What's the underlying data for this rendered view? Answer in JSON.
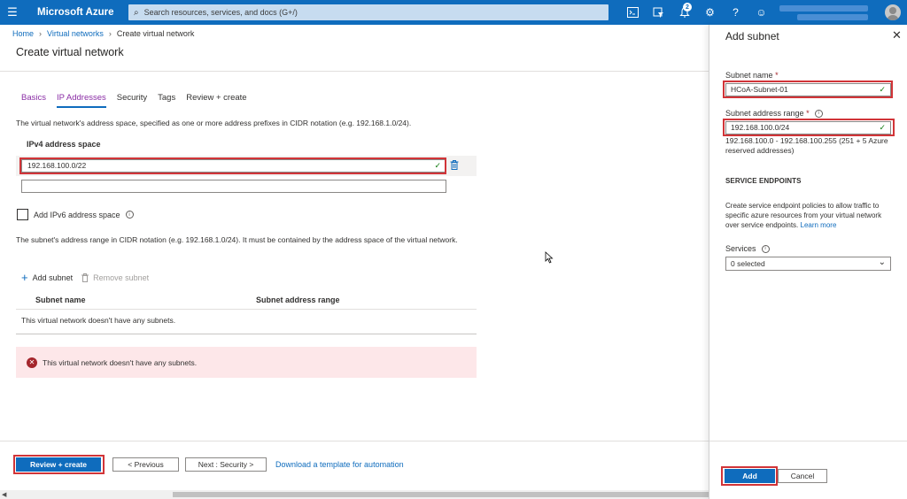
{
  "app": {
    "brand": "Microsoft Azure",
    "search_placeholder": "Search resources, services, and docs (G+/)",
    "notification_count": "2"
  },
  "breadcrumb": [
    "Home",
    "Virtual networks",
    "Create virtual network"
  ],
  "page": {
    "title": "Create virtual network",
    "tabs": [
      {
        "label": "Basics",
        "state": "visited"
      },
      {
        "label": "IP Addresses",
        "state": "active"
      },
      {
        "label": "Security",
        "state": "default"
      },
      {
        "label": "Tags",
        "state": "default"
      },
      {
        "label": "Review + create",
        "state": "default"
      }
    ],
    "address_space_desc": "The virtual network's address space, specified as one or more address prefixes in CIDR notation (e.g. 192.168.1.0/24).",
    "ipv4_label": "IPv4 address space",
    "ipv4_value": "192.168.100.0/22",
    "ipv6_label": "Add IPv6 address space",
    "subnet_desc": "The subnet's address range in CIDR notation (e.g. 192.168.1.0/24). It must be contained by the address space of the virtual network.",
    "add_subnet": "Add subnet",
    "remove_subnet": "Remove subnet",
    "col_subnet_name": "Subnet name",
    "col_subnet_range": "Subnet address range",
    "no_subnets_row": "This virtual network doesn't have any subnets.",
    "error_message": "This virtual network doesn't have any subnets."
  },
  "footer": {
    "review_create": "Review + create",
    "previous": "< Previous",
    "next": "Next : Security >",
    "download": "Download a template for automation"
  },
  "panel": {
    "title": "Add subnet",
    "subnet_name_label": "Subnet name",
    "subnet_name_value": "HCoA-Subnet-01",
    "range_label": "Subnet address range",
    "range_value": "192.168.100.0/24",
    "range_note": "192.168.100.0 - 192.168.100.255 (251 + 5 Azure reserved addresses)",
    "service_endpoints_head": "SERVICE ENDPOINTS",
    "service_endpoints_note": "Create service endpoint policies to allow traffic to specific azure resources from your virtual network over service endpoints.",
    "learn_more": "Learn more",
    "services_label": "Services",
    "services_value": "0 selected",
    "add": "Add",
    "cancel": "Cancel"
  },
  "colors": {
    "azure_blue": "#0f6cbd",
    "highlight_red": "#d13438",
    "error_bg": "#fde7e9",
    "valid_green": "#107c10"
  }
}
